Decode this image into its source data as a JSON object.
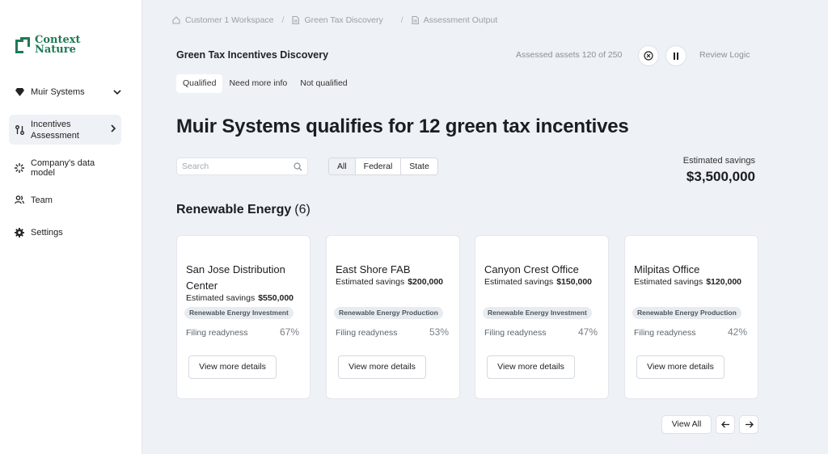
{
  "brand": {
    "line1": "Context",
    "line2": "Nature",
    "color": "#1f7a55"
  },
  "sidebar": {
    "items": [
      {
        "label": "Muir Systems",
        "icon": "diamond-icon",
        "chevron": "chevron-down-icon"
      },
      {
        "label": "Incentives Assessment",
        "icon": "branch-icon",
        "chevron": "chevron-right-icon"
      },
      {
        "label": "Company's data model",
        "icon": "sparkle-icon"
      },
      {
        "label": "Team",
        "icon": "users-icon"
      },
      {
        "label": "Settings",
        "icon": "gear-icon"
      }
    ]
  },
  "breadcrumbs": [
    {
      "label": "Customer 1 Workspace",
      "icon": "home-icon"
    },
    {
      "label": "Green Tax Discovery",
      "icon": "document-icon"
    },
    {
      "label": "Assessment Output",
      "icon": "document-icon"
    }
  ],
  "header": {
    "title": "Green Tax Incentives Discovery",
    "assessed": "Assessed assets 120 of 250",
    "review_logic": "Review Logic"
  },
  "tabs": [
    {
      "label": "Qualified",
      "active": true
    },
    {
      "label": "Need more info"
    },
    {
      "label": "Not qualified"
    }
  ],
  "headline": "Muir Systems qualifies for 12 green tax incentives",
  "search": {
    "placeholder": "Search",
    "value": ""
  },
  "filters": [
    {
      "label": "All",
      "active": true
    },
    {
      "label": "Federal"
    },
    {
      "label": "State"
    }
  ],
  "savings": {
    "label": "Estimated savings",
    "value": "$3,500,000"
  },
  "section": {
    "title": "Renewable Energy",
    "count": "(6)"
  },
  "cards": [
    {
      "name": "San Jose Distribution Center",
      "est_label": "Estimated savings",
      "est_value": "$550,000",
      "badge": "Renewable Energy Investment",
      "ready_label": "Filing readyness",
      "ready_pct": "67%",
      "button": "View more details"
    },
    {
      "name": "East Shore FAB",
      "est_label": "Estimated savings",
      "est_value": "$200,000",
      "badge": "Renewable Energy Production",
      "ready_label": "Filing readyness",
      "ready_pct": "53%",
      "button": "View more details"
    },
    {
      "name": "Canyon Crest Office",
      "est_label": "Estimated savings",
      "est_value": "$150,000",
      "badge": "Renewable Energy Investment",
      "ready_label": "Filing readyness",
      "ready_pct": "47%",
      "button": "View more details"
    },
    {
      "name": "Milpitas Office",
      "est_label": "Estimated savings",
      "est_value": "$120,000",
      "badge": "Renewable Energy Production",
      "ready_label": "Filing readyness",
      "ready_pct": "42%",
      "button": "View more details"
    }
  ],
  "pagination": {
    "view_all": "View All",
    "prev_icon": "arrow-left-icon",
    "next_icon": "arrow-right-icon"
  }
}
